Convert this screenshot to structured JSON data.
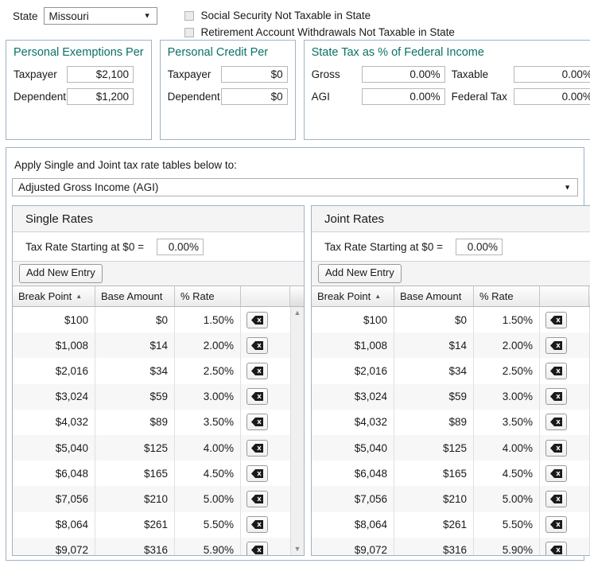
{
  "header": {
    "state_label": "State",
    "state_value": "Missouri",
    "checkbox_social_security": "Social Security Not Taxable in State",
    "checkbox_retirement": "Retirement Account Withdrawals Not Taxable in State",
    "dropdown_icon": "chevron-down-icon"
  },
  "personal_exemptions": {
    "title": "Personal Exemptions Per",
    "taxpayer_label": "Taxpayer",
    "taxpayer_value": "$2,100",
    "dependent_label": "Dependent",
    "dependent_value": "$1,200"
  },
  "personal_credit": {
    "title": "Personal Credit Per",
    "taxpayer_label": "Taxpayer",
    "taxpayer_value": "$0",
    "dependent_label": "Dependent",
    "dependent_value": "$0"
  },
  "state_tax_pct": {
    "title": "State Tax as % of Federal Income",
    "gross_label": "Gross",
    "gross_value": "0.00%",
    "taxable_label": "Taxable",
    "taxable_value": "0.00%",
    "agi_label": "AGI",
    "agi_value": "0.00%",
    "federal_tax_label": "Federal Tax",
    "federal_tax_value": "0.00%"
  },
  "apply": {
    "label": "Apply Single and Joint tax rate tables below to:",
    "selected": "Adjusted Gross Income (AGI)",
    "dropdown_icon": "chevron-down-icon"
  },
  "single_rates": {
    "title": "Single Rates",
    "start_rate_label": "Tax Rate Starting at $0 =",
    "start_rate_value": "0.00%",
    "add_button": "Add New Entry",
    "columns": [
      "Break Point",
      "Base Amount",
      "% Rate",
      ""
    ],
    "sort_column": "Break Point",
    "sort_direction": "ascending",
    "rows": [
      {
        "break_point": "$100",
        "base_amount": "$0",
        "rate": "1.50%",
        "delete_icon": "backspace-delete-icon"
      },
      {
        "break_point": "$1,008",
        "base_amount": "$14",
        "rate": "2.00%",
        "delete_icon": "backspace-delete-icon"
      },
      {
        "break_point": "$2,016",
        "base_amount": "$34",
        "rate": "2.50%",
        "delete_icon": "backspace-delete-icon"
      },
      {
        "break_point": "$3,024",
        "base_amount": "$59",
        "rate": "3.00%",
        "delete_icon": "backspace-delete-icon"
      },
      {
        "break_point": "$4,032",
        "base_amount": "$89",
        "rate": "3.50%",
        "delete_icon": "backspace-delete-icon"
      },
      {
        "break_point": "$5,040",
        "base_amount": "$125",
        "rate": "4.00%",
        "delete_icon": "backspace-delete-icon"
      },
      {
        "break_point": "$6,048",
        "base_amount": "$165",
        "rate": "4.50%",
        "delete_icon": "backspace-delete-icon"
      },
      {
        "break_point": "$7,056",
        "base_amount": "$210",
        "rate": "5.00%",
        "delete_icon": "backspace-delete-icon"
      },
      {
        "break_point": "$8,064",
        "base_amount": "$261",
        "rate": "5.50%",
        "delete_icon": "backspace-delete-icon"
      },
      {
        "break_point": "$9,072",
        "base_amount": "$316",
        "rate": "5.90%",
        "delete_icon": "backspace-delete-icon"
      }
    ]
  },
  "joint_rates": {
    "title": "Joint Rates",
    "start_rate_label": "Tax Rate Starting at $0 =",
    "start_rate_value": "0.00%",
    "add_button": "Add New Entry",
    "columns": [
      "Break Point",
      "Base Amount",
      "% Rate",
      ""
    ],
    "sort_column": "Break Point",
    "sort_direction": "ascending",
    "rows": [
      {
        "break_point": "$100",
        "base_amount": "$0",
        "rate": "1.50%",
        "delete_icon": "backspace-delete-icon"
      },
      {
        "break_point": "$1,008",
        "base_amount": "$14",
        "rate": "2.00%",
        "delete_icon": "backspace-delete-icon"
      },
      {
        "break_point": "$2,016",
        "base_amount": "$34",
        "rate": "2.50%",
        "delete_icon": "backspace-delete-icon"
      },
      {
        "break_point": "$3,024",
        "base_amount": "$59",
        "rate": "3.00%",
        "delete_icon": "backspace-delete-icon"
      },
      {
        "break_point": "$4,032",
        "base_amount": "$89",
        "rate": "3.50%",
        "delete_icon": "backspace-delete-icon"
      },
      {
        "break_point": "$5,040",
        "base_amount": "$125",
        "rate": "4.00%",
        "delete_icon": "backspace-delete-icon"
      },
      {
        "break_point": "$6,048",
        "base_amount": "$165",
        "rate": "4.50%",
        "delete_icon": "backspace-delete-icon"
      },
      {
        "break_point": "$7,056",
        "base_amount": "$210",
        "rate": "5.00%",
        "delete_icon": "backspace-delete-icon"
      },
      {
        "break_point": "$8,064",
        "base_amount": "$261",
        "rate": "5.50%",
        "delete_icon": "backspace-delete-icon"
      },
      {
        "break_point": "$9,072",
        "base_amount": "$316",
        "rate": "5.90%",
        "delete_icon": "backspace-delete-icon"
      }
    ]
  },
  "scrollbar": {
    "up_icon": "triangle-up-icon",
    "down_icon": "triangle-down-icon"
  },
  "colors": {
    "panel_border": "#9fb3c4",
    "panel_title": "#0a7166",
    "row_alt": "#f7f7f7",
    "header_band": "#f4f4f4"
  }
}
